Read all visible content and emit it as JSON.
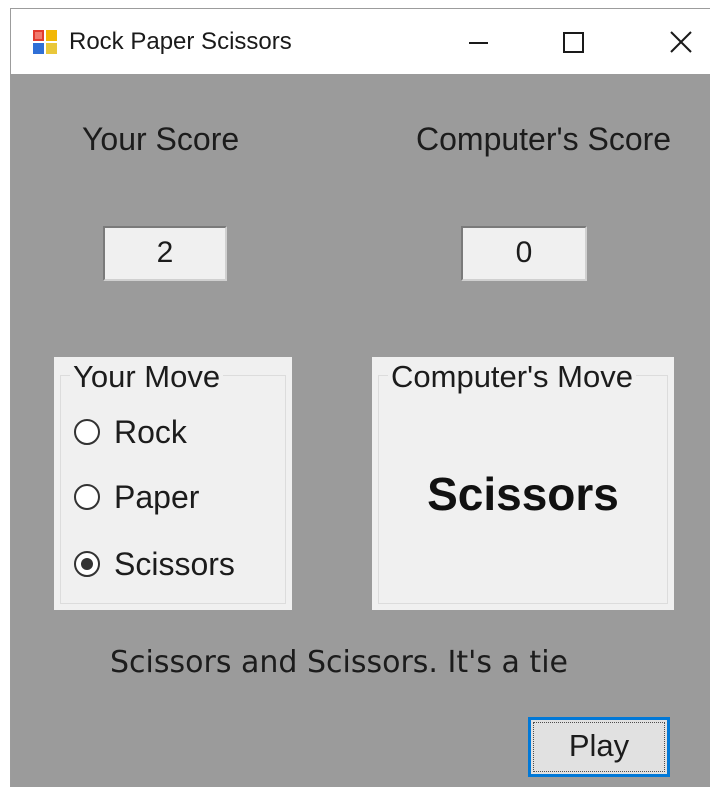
{
  "window": {
    "title": "Rock Paper Scissors",
    "icons": {
      "app": "app-grid-icon",
      "minimize": "minimize-icon",
      "maximize": "maximize-icon",
      "close": "close-icon"
    }
  },
  "scores": {
    "your_label": "Your Score",
    "your_value": "2",
    "computer_label": "Computer's Score",
    "computer_value": "0"
  },
  "your_move": {
    "title": "Your Move",
    "options": [
      {
        "label": "Rock",
        "checked": false
      },
      {
        "label": "Paper",
        "checked": false
      },
      {
        "label": "Scissors",
        "checked": true
      }
    ]
  },
  "computer_move": {
    "title": "Computer's Move",
    "value": "Scissors"
  },
  "result": "Scissors and Scissors. It's a tie",
  "play_button": "Play",
  "colors": {
    "form_background": "#9b9b9b",
    "panel_background": "#f0f0f0",
    "focus_border": "#0078d7"
  }
}
